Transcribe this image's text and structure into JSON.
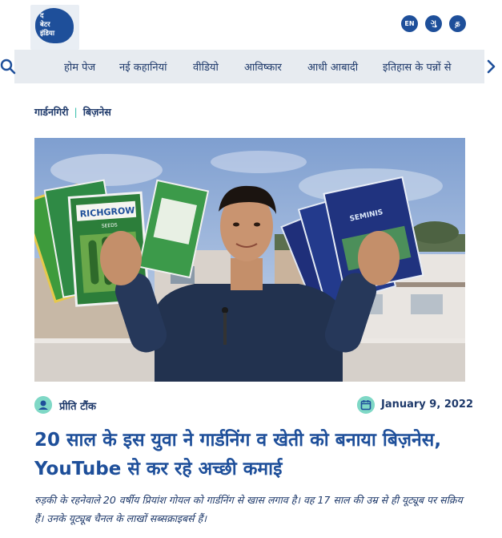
{
  "header": {
    "logo_lines": [
      "द",
      "बेटर",
      "इंडिया"
    ],
    "languages": [
      "EN",
      "ગુ",
      "த"
    ]
  },
  "nav": {
    "items": [
      "होम पेज",
      "नई कहानियां",
      "वीडियो",
      "आविष्कार",
      "आधी आबादी",
      "इतिहास के पन्नों से"
    ],
    "search_icon": "search-icon",
    "next_icon": "chevron-right-icon"
  },
  "breadcrumb": {
    "items": [
      "गार्डनगिरी",
      "बिज़नेस"
    ],
    "separator": "|"
  },
  "hero_image": {
    "packet_brand": "RICHGROW",
    "packet_sub": "SEEDS",
    "packet_right": "SEMINIS"
  },
  "article": {
    "author": "प्रीति टौंक",
    "date": "January 9, 2022",
    "title": "20 साल के इस युवा ने गार्डनिंग व खेती को बनाया बिज़नेस, YouTube से कर रहे अच्छी कमाई",
    "dek": "रुड़की के रहनेवाले 20 वर्षीय प्रियांश गोयल को गार्डनिंग से खास लगाव है। वह 17 साल की उम्र से ही यूट्यूब पर सक्रिय हैं। उनके यूट्यूब चैनल के लाखों सब्सक्राइबर्स हैं।"
  },
  "colors": {
    "brand": "#1e4f9a",
    "accent": "#3bbfad",
    "nav_bg": "#e7ebf0"
  }
}
